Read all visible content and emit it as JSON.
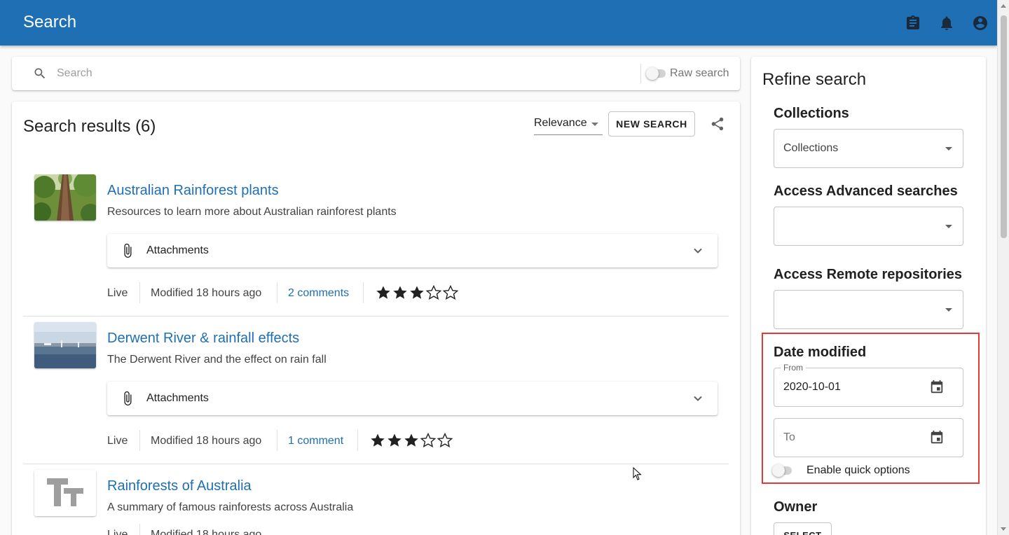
{
  "appbar": {
    "title": "Search",
    "icons": [
      "clipboard-icon",
      "bell-icon",
      "account-circle-icon"
    ]
  },
  "search": {
    "placeholder": "Search",
    "value": "",
    "raw_search_label": "Raw search",
    "raw_search_enabled": false
  },
  "results": {
    "heading": "Search results (6)",
    "sort_value": "Relevance",
    "new_search_label": "NEW SEARCH",
    "items": [
      {
        "title": "Australian Rainforest plants",
        "description": "Resources to learn more about Australian rainforest plants",
        "attachments_label": "Attachments",
        "status": "Live",
        "modified": "Modified 18 hours ago",
        "comments": "2 comments",
        "rating": 3
      },
      {
        "title": "Derwent River & rainfall effects",
        "description": "The Derwent River and the effect on rain fall",
        "attachments_label": "Attachments",
        "status": "Live",
        "modified": "Modified 18 hours ago",
        "comments": "1 comment",
        "rating": 3
      },
      {
        "title": "Rainforests of Australia",
        "description": "A summary of famous rainforests across Australia",
        "status": "Live",
        "modified": "Modified 18 hours ago"
      }
    ]
  },
  "refine": {
    "title": "Refine search",
    "collections": {
      "heading": "Collections",
      "value": "Collections"
    },
    "advanced": {
      "heading": "Access Advanced searches",
      "value": ""
    },
    "remote": {
      "heading": "Access Remote repositories",
      "value": ""
    },
    "date_modified": {
      "heading": "Date modified",
      "from_label": "From",
      "from_value": "2020-10-01",
      "to_placeholder": "To",
      "quick_options_label": "Enable quick options",
      "quick_options_enabled": false
    },
    "owner": {
      "heading": "Owner",
      "select_label": "SELECT"
    }
  },
  "colors": {
    "appbar": "#1e6fb3",
    "link": "#1e6fb3",
    "highlight": "#e53935"
  }
}
